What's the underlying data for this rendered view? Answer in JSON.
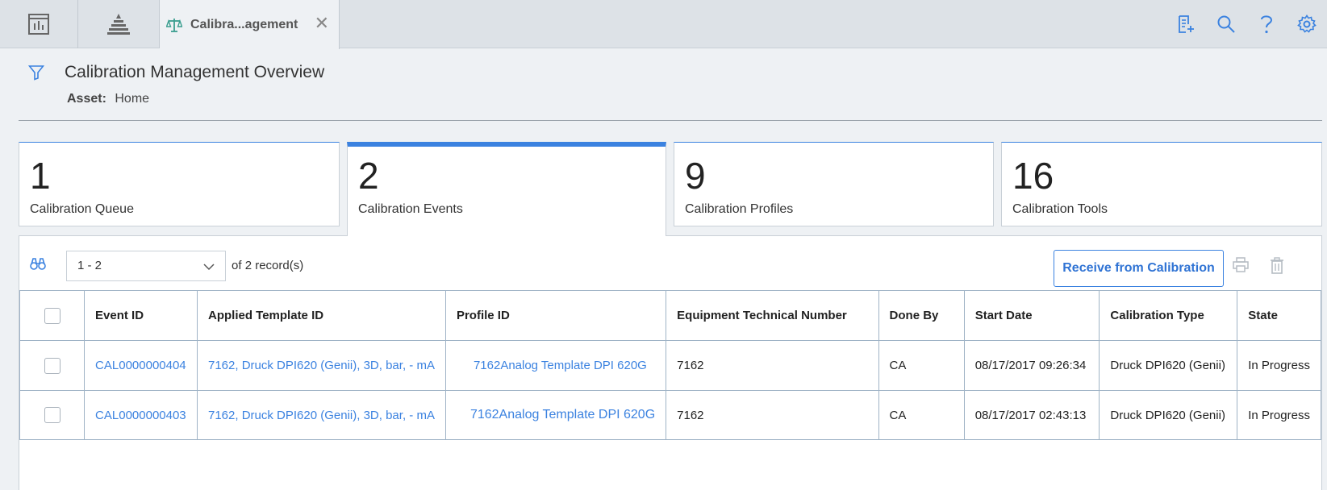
{
  "top_tabs": {
    "active_tab_label": "Calibra...agement",
    "close_symbol": "✕"
  },
  "header": {
    "title": "Calibration Management Overview",
    "asset_label": "Asset:",
    "asset_value": "Home"
  },
  "cards": [
    {
      "count": "1",
      "label": "Calibration Queue"
    },
    {
      "count": "2",
      "label": "Calibration Events"
    },
    {
      "count": "9",
      "label": "Calibration Profiles"
    },
    {
      "count": "16",
      "label": "Calibration Tools"
    }
  ],
  "toolbar": {
    "range_value": "1 - 2",
    "of_label": "of",
    "total": "2",
    "records_label": "record(s)",
    "receive_label": "Receive from Calibration"
  },
  "table": {
    "headers": [
      "Event ID",
      "Applied Template ID",
      "Profile ID",
      "Equipment Technical Number",
      "Done By",
      "Start Date",
      "Calibration Type",
      "State"
    ],
    "rows": [
      [
        "CAL0000000404",
        "7162, Druck DPI620 (Genii), 3D, bar, - mA",
        "7162Analog Template DPI 620G",
        "7162",
        "CA",
        "08/17/2017 09:26:34",
        "Druck DPI620 (Genii)",
        "In Progress"
      ],
      [
        "CAL0000000403",
        "7162, Druck DPI620 (Genii), 3D, bar, - mA",
        "7162Analog Template DPI 620G",
        "7162",
        "CA",
        "08/17/2017 02:43:13",
        "Druck DPI620 (Genii)",
        "In Progress"
      ]
    ]
  },
  "colors": {
    "accent": "#3b82e0",
    "link": "#3b82e0",
    "background": "#eef1f4"
  },
  "icons": [
    "dashboard-icon",
    "hierarchy-icon",
    "scales-icon",
    "close-icon",
    "new-document-icon",
    "search-icon",
    "help-icon",
    "settings-icon",
    "filter-icon",
    "binoculars-icon",
    "chevron-down-icon",
    "print-icon",
    "trash-icon"
  ]
}
